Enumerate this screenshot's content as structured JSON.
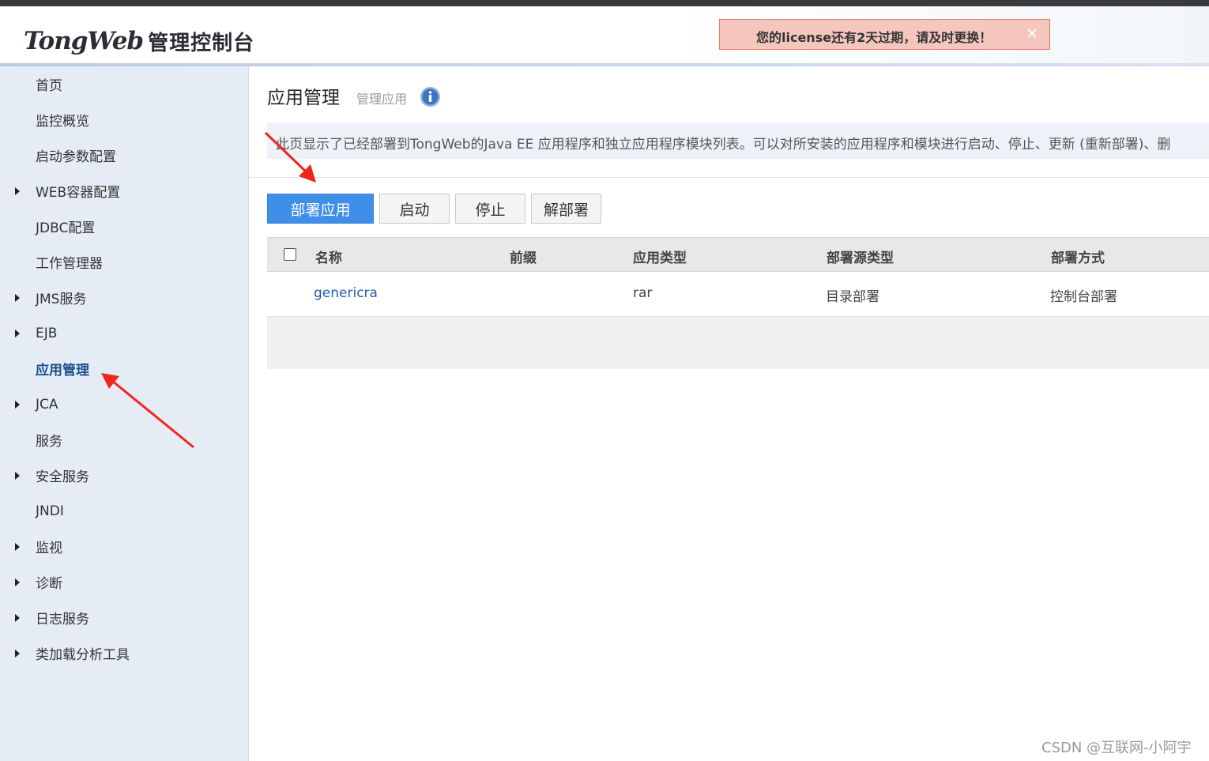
{
  "header": {
    "logo_brand": "TongWeb",
    "logo_sub": "管理控制台",
    "license_notice": "您的license还有2天过期，请及时更换！",
    "close_glyph": "✕"
  },
  "sidebar": {
    "items": [
      {
        "label": "首页",
        "expandable": false
      },
      {
        "label": "监控概览",
        "expandable": false
      },
      {
        "label": "启动参数配置",
        "expandable": false
      },
      {
        "label": "WEB容器配置",
        "expandable": true
      },
      {
        "label": "JDBC配置",
        "expandable": false
      },
      {
        "label": "工作管理器",
        "expandable": false
      },
      {
        "label": "JMS服务",
        "expandable": true
      },
      {
        "label": "EJB",
        "expandable": true
      },
      {
        "label": "应用管理",
        "expandable": false,
        "active": true
      },
      {
        "label": "JCA",
        "expandable": true
      },
      {
        "label": "服务",
        "expandable": false
      },
      {
        "label": "安全服务",
        "expandable": true
      },
      {
        "label": "JNDI",
        "expandable": false
      },
      {
        "label": "监视",
        "expandable": true
      },
      {
        "label": "诊断",
        "expandable": true
      },
      {
        "label": "日志服务",
        "expandable": true
      },
      {
        "label": "类加载分析工具",
        "expandable": true
      }
    ]
  },
  "main": {
    "title": "应用管理",
    "subtitle": "管理应用",
    "description": "此页显示了已经部署到TongWeb的Java EE 应用程序和独立应用程序模块列表。可以对所安装的应用程序和模块进行启动、停止、更新 (重新部署)、删",
    "toolbar": {
      "deploy": "部署应用",
      "start": "启动",
      "stop": "停止",
      "undeploy": "解部署"
    },
    "table": {
      "columns": [
        "名称",
        "前缀",
        "应用类型",
        "部署源类型",
        "部署方式"
      ],
      "rows": [
        {
          "name": "genericra",
          "prefix": "",
          "type": "rar",
          "source": "目录部署",
          "method": "控制台部署"
        }
      ]
    }
  },
  "watermark": "CSDN @互联网-小阿宇",
  "colors": {
    "primary": "#3f8ee8",
    "sidebar_bg": "#e5ecf5",
    "license_bg": "#f5c6bd",
    "arrow": "#f0261d",
    "link": "#1f5ea8"
  }
}
